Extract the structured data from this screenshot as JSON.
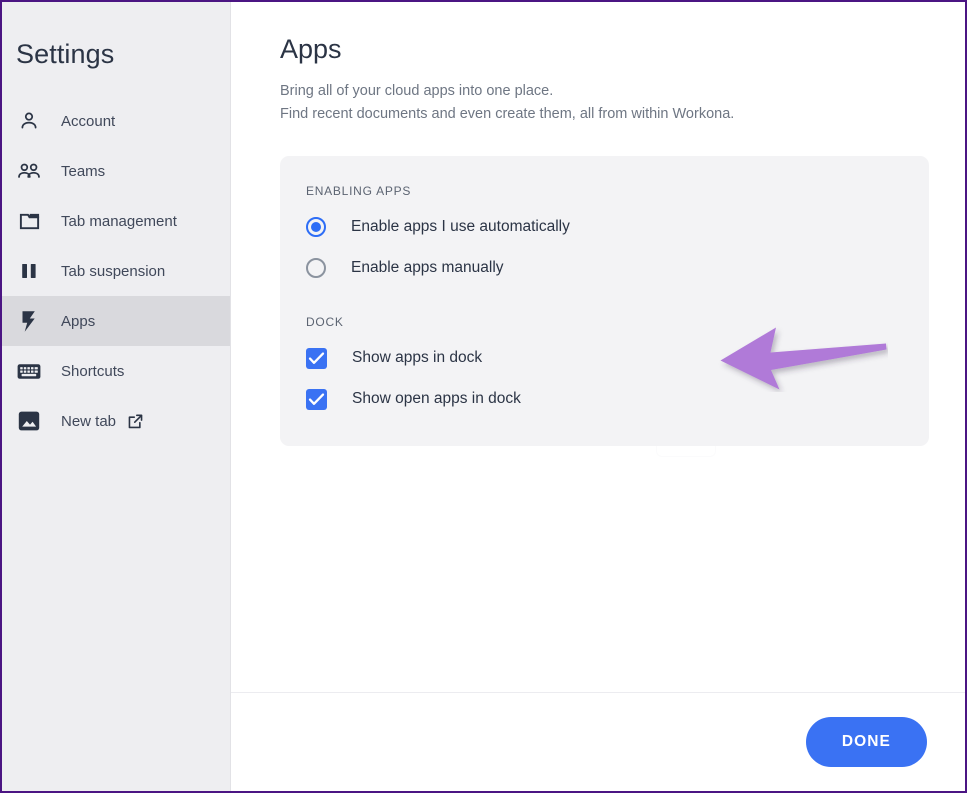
{
  "window": {
    "frame_color": "#4b1583"
  },
  "sidebar": {
    "title": "Settings",
    "items": [
      {
        "label": "Account",
        "icon": "person-icon",
        "active": false,
        "external": false
      },
      {
        "label": "Teams",
        "icon": "people-icon",
        "active": false,
        "external": false
      },
      {
        "label": "Tab management",
        "icon": "folder-icon",
        "active": false,
        "external": false
      },
      {
        "label": "Tab suspension",
        "icon": "pause-icon",
        "active": false,
        "external": false
      },
      {
        "label": "Apps",
        "icon": "lightning-icon",
        "active": true,
        "external": false
      },
      {
        "label": "Shortcuts",
        "icon": "keyboard-icon",
        "active": false,
        "external": false
      },
      {
        "label": "New tab",
        "icon": "image-icon",
        "active": false,
        "external": true
      }
    ]
  },
  "main": {
    "title": "Apps",
    "subtitle_line1": "Bring all of your cloud apps into one place.",
    "subtitle_line2": "Find recent documents and even create them, all from within Workona.",
    "card": {
      "groups": [
        {
          "heading": "ENABLING APPS",
          "control_type": "radio",
          "options": [
            {
              "label": "Enable apps I use automatically",
              "checked": true
            },
            {
              "label": "Enable apps manually",
              "checked": false
            }
          ]
        },
        {
          "heading": "DOCK",
          "control_type": "checkbox",
          "options": [
            {
              "label": "Show apps in dock",
              "checked": true
            },
            {
              "label": "Show open apps in dock",
              "checked": true
            }
          ]
        }
      ]
    }
  },
  "annotation": {
    "type": "arrow",
    "direction": "left",
    "color": "#b07ad8",
    "points_at": "Show apps in dock"
  },
  "footer": {
    "done_label": "DONE"
  },
  "colors": {
    "accent_blue": "#3a72f3",
    "radio_blue": "#2d6df6",
    "sidebar_bg": "#eeeef1",
    "sidebar_active_bg": "#d9d9dd",
    "card_bg": "#f3f3f5",
    "text_dark": "#2b3445",
    "text_muted": "#6e7683",
    "annotation_purple": "#b07ad8",
    "frame_purple": "#4b1583"
  }
}
